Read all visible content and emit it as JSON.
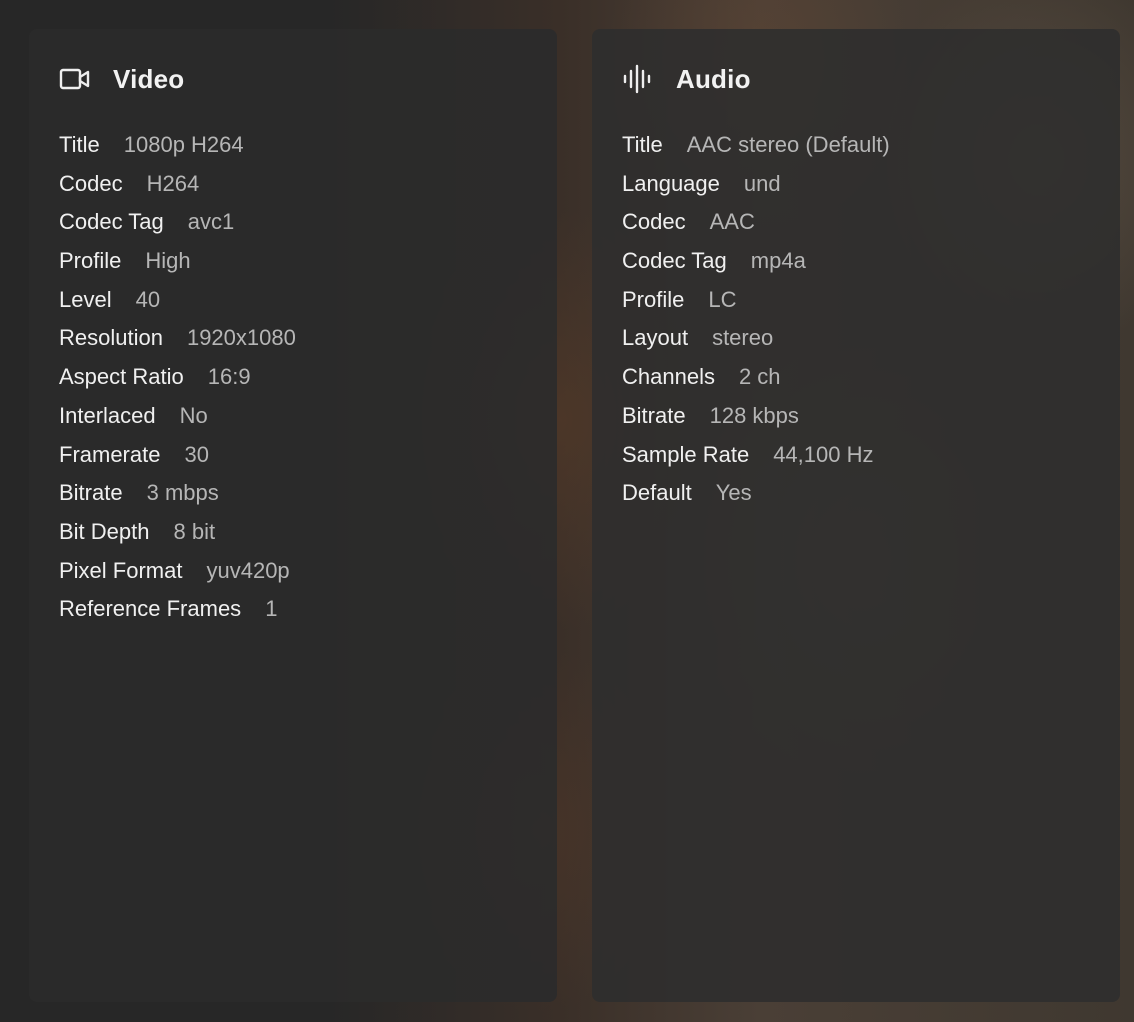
{
  "video": {
    "icon": "video-camera-icon",
    "title": "Video",
    "rows": [
      {
        "label": "Title",
        "value": "1080p H264"
      },
      {
        "label": "Codec",
        "value": "H264"
      },
      {
        "label": "Codec Tag",
        "value": "avc1"
      },
      {
        "label": "Profile",
        "value": "High"
      },
      {
        "label": "Level",
        "value": "40"
      },
      {
        "label": "Resolution",
        "value": "1920x1080"
      },
      {
        "label": "Aspect Ratio",
        "value": "16:9"
      },
      {
        "label": "Interlaced",
        "value": "No"
      },
      {
        "label": "Framerate",
        "value": "30"
      },
      {
        "label": "Bitrate",
        "value": "3 mbps"
      },
      {
        "label": "Bit Depth",
        "value": "8 bit"
      },
      {
        "label": "Pixel Format",
        "value": "yuv420p"
      },
      {
        "label": "Reference Frames",
        "value": "1"
      }
    ]
  },
  "audio": {
    "icon": "audio-waveform-icon",
    "title": "Audio",
    "rows": [
      {
        "label": "Title",
        "value": "AAC stereo (Default)"
      },
      {
        "label": "Language",
        "value": "und"
      },
      {
        "label": "Codec",
        "value": "AAC"
      },
      {
        "label": "Codec Tag",
        "value": "mp4a"
      },
      {
        "label": "Profile",
        "value": "LC"
      },
      {
        "label": "Layout",
        "value": "stereo"
      },
      {
        "label": "Channels",
        "value": "2 ch"
      },
      {
        "label": "Bitrate",
        "value": "128 kbps"
      },
      {
        "label": "Sample Rate",
        "value": "44,100 Hz"
      },
      {
        "label": "Default",
        "value": "Yes"
      }
    ]
  }
}
